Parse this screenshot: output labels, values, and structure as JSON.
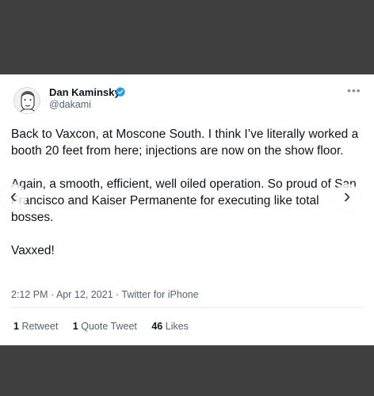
{
  "author": {
    "name": "Dan Kaminsky",
    "handle": "@dakami",
    "verified_color": "#1d9bf0"
  },
  "tweet": {
    "paragraph_1": "Back to Vaxcon, at Moscone South. I think I’ve literally worked a booth 20 feet from here; injections are now on the show floor.",
    "paragraph_2": "Again, a smooth, efficient, well oiled operation.  So proud of San Francisco and Kaiser Permanente for executing like total bosses.",
    "paragraph_3": "Vaxxed!"
  },
  "meta": {
    "timestamp": "2:12 PM · Apr 12, 2021 · Twitter for iPhone"
  },
  "stats": {
    "retweets_count": "1",
    "retweets_label": "Retweet",
    "quotes_count": "1",
    "quotes_label": "Quote Tweet",
    "likes_count": "46",
    "likes_label": "Likes"
  },
  "icons": {
    "more": "more-options-icon",
    "verified": "verified-badge-icon",
    "carousel_left": "chevron-left-icon",
    "carousel_right": "chevron-right-icon"
  },
  "colors": {
    "background": "#404040",
    "card": "#ffffff",
    "text_primary": "#0f1419",
    "text_secondary": "#536471"
  }
}
